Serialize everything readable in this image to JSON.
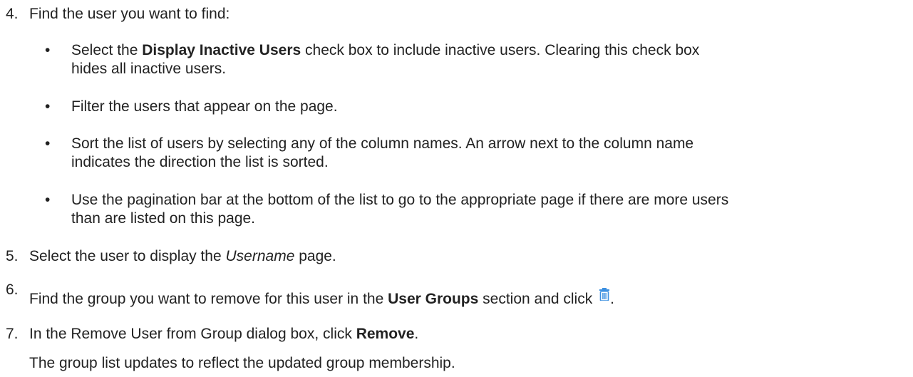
{
  "steps": {
    "s4": {
      "num": "4.",
      "text": "Find the user you want to find:"
    },
    "bullets": [
      {
        "dot": "•",
        "pre": "Select the ",
        "bold": "Display Inactive Users",
        "line1_rest": " check box to include inactive users. Clearing this check box",
        "line2": "hides all inactive users."
      },
      {
        "dot": "•",
        "text": "Filter the users that appear on the page."
      },
      {
        "dot": "•",
        "line1": "Sort the list of users by selecting any of the column names. An arrow next to the column name",
        "line2": "indicates the direction the list is sorted."
      },
      {
        "dot": "•",
        "line1": "Use the pagination bar at the bottom of the list to go to the appropriate page if there are more users",
        "line2": "than are listed on this page."
      }
    ],
    "s5": {
      "num": "5.",
      "pre": "Select the user to display the ",
      "italic": "Username",
      "post": " page."
    },
    "s6": {
      "num": "6.",
      "pre": "Find the group you want to remove for this user in the ",
      "bold": "User Groups",
      "post": " section and click",
      "end": ".",
      "icon": "trash-icon",
      "icon_color": "#3b8fe0"
    },
    "s7": {
      "num": "7.",
      "pre": "In the Remove User from Group dialog box, click ",
      "bold": "Remove",
      "post": "."
    },
    "result": "The group list updates to reflect the updated group membership."
  }
}
